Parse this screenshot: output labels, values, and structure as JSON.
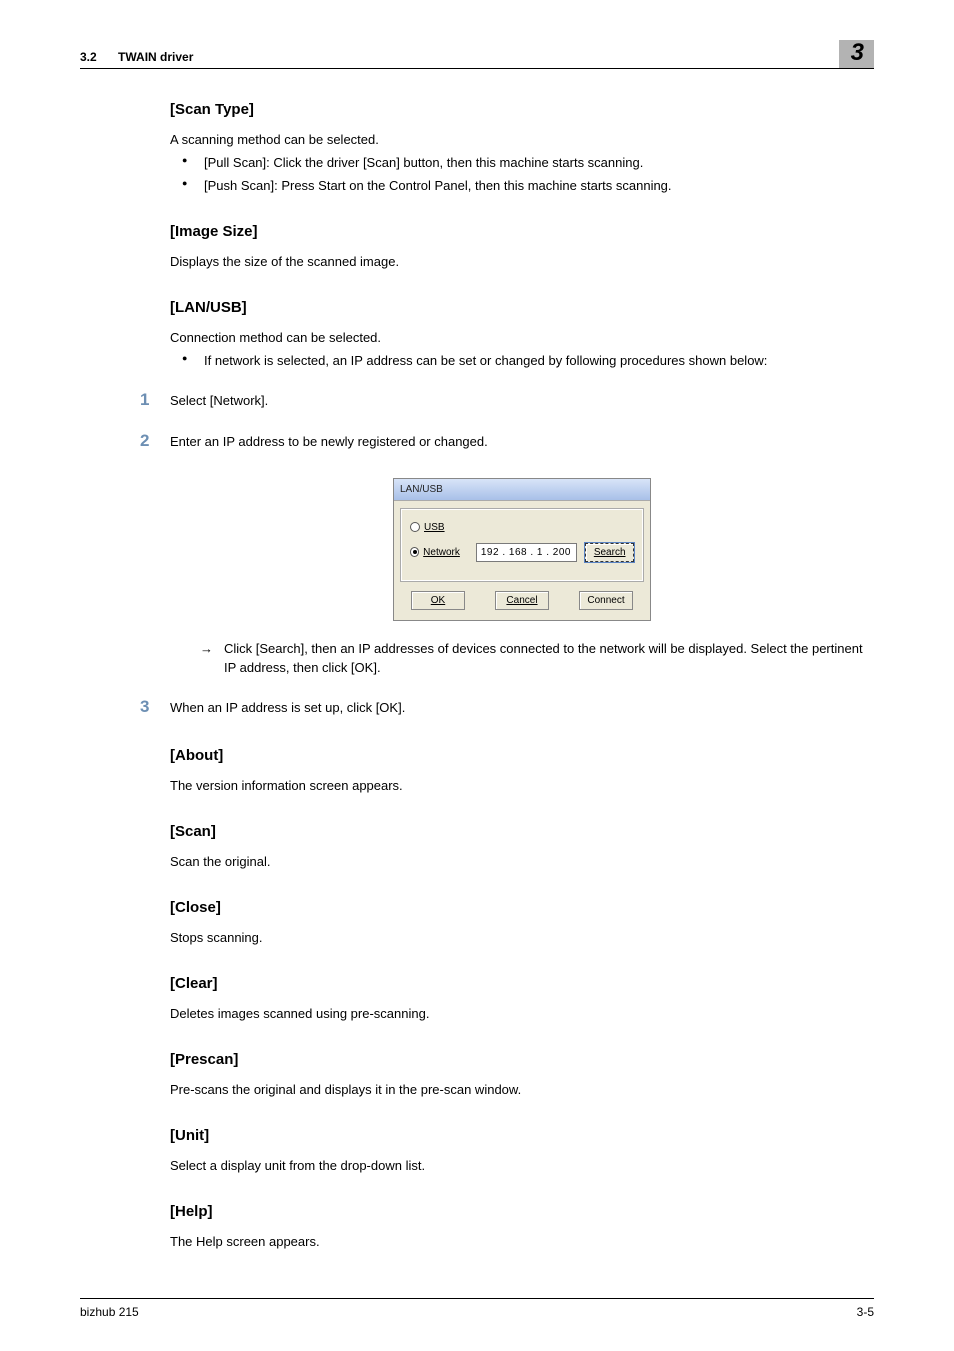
{
  "header": {
    "section_number": "3.2",
    "section_title": "TWAIN driver",
    "chapter_number": "3"
  },
  "sections": {
    "scan_type": {
      "heading": "[Scan Type]",
      "intro": "A scanning method can be selected.",
      "bullets": [
        "[Pull Scan]: Click the driver [Scan] button, then this machine starts scanning.",
        "[Push Scan]: Press Start on the Control Panel, then this machine starts scanning."
      ]
    },
    "image_size": {
      "heading": "[Image Size]",
      "body": "Displays the size of the scanned image."
    },
    "lan_usb": {
      "heading": "[LAN/USB]",
      "intro": "Connection method can be selected.",
      "bullets": [
        "If network is selected, an IP address can be set or changed by following procedures shown below:"
      ],
      "steps": {
        "s1": "Select [Network].",
        "s2": "Enter an IP address to be newly registered or changed.",
        "arrow": "Click [Search], then an IP addresses of devices connected to the network will be displayed. Select the pertinent IP address, then click [OK].",
        "s3": "When an IP address is set up, click [OK]."
      }
    },
    "about": {
      "heading": "[About]",
      "body": "The version information screen appears."
    },
    "scan": {
      "heading": "[Scan]",
      "body": "Scan the original."
    },
    "close": {
      "heading": "[Close]",
      "body": "Stops scanning."
    },
    "clear": {
      "heading": "[Clear]",
      "body": "Deletes images scanned using pre-scanning."
    },
    "prescan": {
      "heading": "[Prescan]",
      "body": "Pre-scans the original and displays it in the pre-scan window."
    },
    "unit": {
      "heading": "[Unit]",
      "body": "Select a display unit from the drop-down list."
    },
    "help": {
      "heading": "[Help]",
      "body": "The Help screen appears."
    }
  },
  "dialog": {
    "title": "LAN/USB",
    "usb_label": "USB",
    "network_label": "Network",
    "ip_value": "192 . 168 .  1  . 200",
    "search_label": "Search",
    "ok_label": "OK",
    "cancel_label": "Cancel",
    "connect_label": "Connect"
  },
  "step_numbers": {
    "n1": "1",
    "n2": "2",
    "n3": "3"
  },
  "arrow_symbol": "→",
  "footer": {
    "left": "bizhub 215",
    "right": "3-5"
  }
}
